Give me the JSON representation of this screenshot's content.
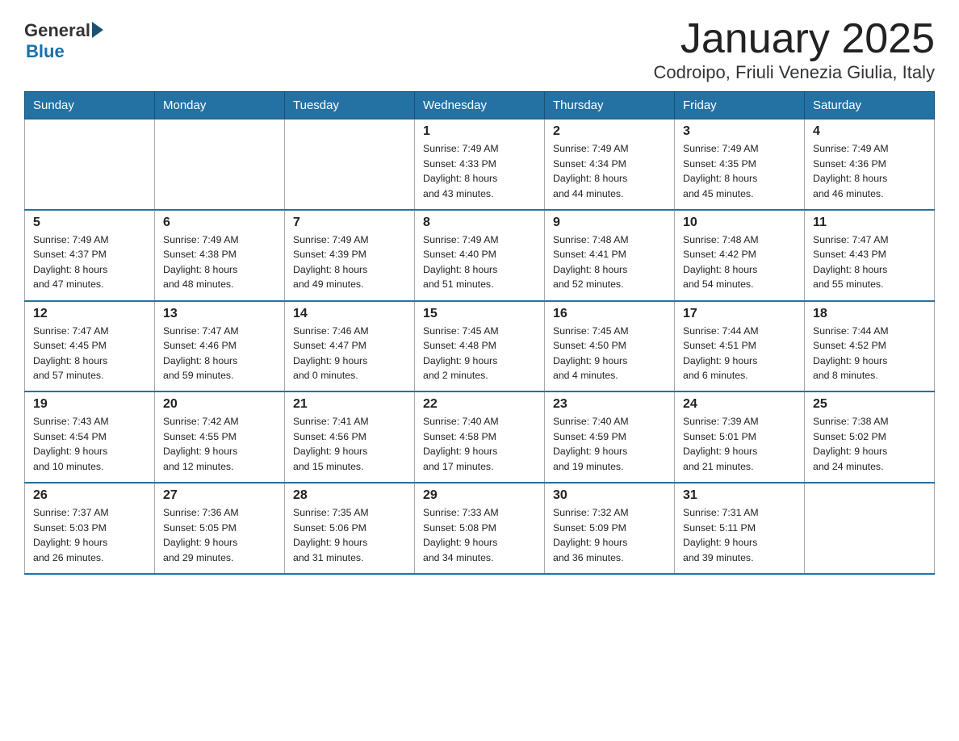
{
  "header": {
    "title": "January 2025",
    "subtitle": "Codroipo, Friuli Venezia Giulia, Italy",
    "logo_general": "General",
    "logo_blue": "Blue"
  },
  "days_of_week": [
    "Sunday",
    "Monday",
    "Tuesday",
    "Wednesday",
    "Thursday",
    "Friday",
    "Saturday"
  ],
  "weeks": [
    [
      {
        "day": "",
        "info": ""
      },
      {
        "day": "",
        "info": ""
      },
      {
        "day": "",
        "info": ""
      },
      {
        "day": "1",
        "info": "Sunrise: 7:49 AM\nSunset: 4:33 PM\nDaylight: 8 hours\nand 43 minutes."
      },
      {
        "day": "2",
        "info": "Sunrise: 7:49 AM\nSunset: 4:34 PM\nDaylight: 8 hours\nand 44 minutes."
      },
      {
        "day": "3",
        "info": "Sunrise: 7:49 AM\nSunset: 4:35 PM\nDaylight: 8 hours\nand 45 minutes."
      },
      {
        "day": "4",
        "info": "Sunrise: 7:49 AM\nSunset: 4:36 PM\nDaylight: 8 hours\nand 46 minutes."
      }
    ],
    [
      {
        "day": "5",
        "info": "Sunrise: 7:49 AM\nSunset: 4:37 PM\nDaylight: 8 hours\nand 47 minutes."
      },
      {
        "day": "6",
        "info": "Sunrise: 7:49 AM\nSunset: 4:38 PM\nDaylight: 8 hours\nand 48 minutes."
      },
      {
        "day": "7",
        "info": "Sunrise: 7:49 AM\nSunset: 4:39 PM\nDaylight: 8 hours\nand 49 minutes."
      },
      {
        "day": "8",
        "info": "Sunrise: 7:49 AM\nSunset: 4:40 PM\nDaylight: 8 hours\nand 51 minutes."
      },
      {
        "day": "9",
        "info": "Sunrise: 7:48 AM\nSunset: 4:41 PM\nDaylight: 8 hours\nand 52 minutes."
      },
      {
        "day": "10",
        "info": "Sunrise: 7:48 AM\nSunset: 4:42 PM\nDaylight: 8 hours\nand 54 minutes."
      },
      {
        "day": "11",
        "info": "Sunrise: 7:47 AM\nSunset: 4:43 PM\nDaylight: 8 hours\nand 55 minutes."
      }
    ],
    [
      {
        "day": "12",
        "info": "Sunrise: 7:47 AM\nSunset: 4:45 PM\nDaylight: 8 hours\nand 57 minutes."
      },
      {
        "day": "13",
        "info": "Sunrise: 7:47 AM\nSunset: 4:46 PM\nDaylight: 8 hours\nand 59 minutes."
      },
      {
        "day": "14",
        "info": "Sunrise: 7:46 AM\nSunset: 4:47 PM\nDaylight: 9 hours\nand 0 minutes."
      },
      {
        "day": "15",
        "info": "Sunrise: 7:45 AM\nSunset: 4:48 PM\nDaylight: 9 hours\nand 2 minutes."
      },
      {
        "day": "16",
        "info": "Sunrise: 7:45 AM\nSunset: 4:50 PM\nDaylight: 9 hours\nand 4 minutes."
      },
      {
        "day": "17",
        "info": "Sunrise: 7:44 AM\nSunset: 4:51 PM\nDaylight: 9 hours\nand 6 minutes."
      },
      {
        "day": "18",
        "info": "Sunrise: 7:44 AM\nSunset: 4:52 PM\nDaylight: 9 hours\nand 8 minutes."
      }
    ],
    [
      {
        "day": "19",
        "info": "Sunrise: 7:43 AM\nSunset: 4:54 PM\nDaylight: 9 hours\nand 10 minutes."
      },
      {
        "day": "20",
        "info": "Sunrise: 7:42 AM\nSunset: 4:55 PM\nDaylight: 9 hours\nand 12 minutes."
      },
      {
        "day": "21",
        "info": "Sunrise: 7:41 AM\nSunset: 4:56 PM\nDaylight: 9 hours\nand 15 minutes."
      },
      {
        "day": "22",
        "info": "Sunrise: 7:40 AM\nSunset: 4:58 PM\nDaylight: 9 hours\nand 17 minutes."
      },
      {
        "day": "23",
        "info": "Sunrise: 7:40 AM\nSunset: 4:59 PM\nDaylight: 9 hours\nand 19 minutes."
      },
      {
        "day": "24",
        "info": "Sunrise: 7:39 AM\nSunset: 5:01 PM\nDaylight: 9 hours\nand 21 minutes."
      },
      {
        "day": "25",
        "info": "Sunrise: 7:38 AM\nSunset: 5:02 PM\nDaylight: 9 hours\nand 24 minutes."
      }
    ],
    [
      {
        "day": "26",
        "info": "Sunrise: 7:37 AM\nSunset: 5:03 PM\nDaylight: 9 hours\nand 26 minutes."
      },
      {
        "day": "27",
        "info": "Sunrise: 7:36 AM\nSunset: 5:05 PM\nDaylight: 9 hours\nand 29 minutes."
      },
      {
        "day": "28",
        "info": "Sunrise: 7:35 AM\nSunset: 5:06 PM\nDaylight: 9 hours\nand 31 minutes."
      },
      {
        "day": "29",
        "info": "Sunrise: 7:33 AM\nSunset: 5:08 PM\nDaylight: 9 hours\nand 34 minutes."
      },
      {
        "day": "30",
        "info": "Sunrise: 7:32 AM\nSunset: 5:09 PM\nDaylight: 9 hours\nand 36 minutes."
      },
      {
        "day": "31",
        "info": "Sunrise: 7:31 AM\nSunset: 5:11 PM\nDaylight: 9 hours\nand 39 minutes."
      },
      {
        "day": "",
        "info": ""
      }
    ]
  ]
}
